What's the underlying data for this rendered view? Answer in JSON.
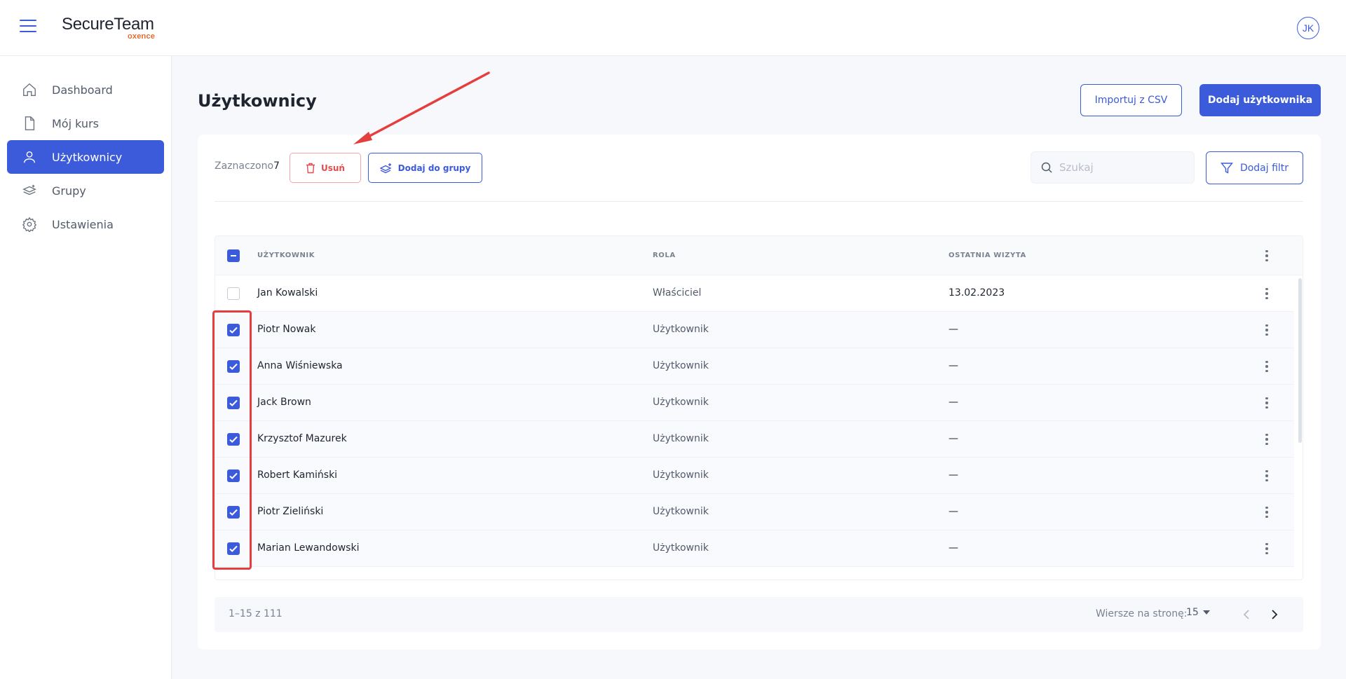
{
  "header": {
    "logo_main": "SecureTeam",
    "logo_sub": "oxence",
    "avatar_initials": "JK"
  },
  "sidebar": {
    "items": [
      {
        "label": "Dashboard",
        "icon": "home-icon"
      },
      {
        "label": "Mój kurs",
        "icon": "document-icon"
      },
      {
        "label": "Użytkownicy",
        "icon": "user-icon",
        "active": true
      },
      {
        "label": "Grupy",
        "icon": "layers-icon"
      },
      {
        "label": "Ustawienia",
        "icon": "gear-icon"
      }
    ]
  },
  "page": {
    "title": "Użytkownicy",
    "import_label": "Importuj z CSV",
    "add_user_label": "Dodaj użytkownika"
  },
  "toolbar": {
    "selected_label": "Zaznaczono",
    "selected_count": "7",
    "delete_label": "Usuń",
    "add_to_group_label": "Dodaj do grupy",
    "search_placeholder": "Szukaj",
    "filter_label": "Dodaj filtr"
  },
  "table": {
    "columns": [
      "UŻYTKOWNIK",
      "ROLA",
      "OSTATNIA WIZYTA"
    ],
    "rows": [
      {
        "name": "Jan Kowalski",
        "role": "Właściciel",
        "last_visit": "13.02.2023",
        "checked": false
      },
      {
        "name": "Piotr Nowak",
        "role": "Użytkownik",
        "last_visit": "—",
        "checked": true
      },
      {
        "name": "Anna Wiśniewska",
        "role": "Użytkownik",
        "last_visit": "—",
        "checked": true
      },
      {
        "name": "Jack Brown",
        "role": "Użytkownik",
        "last_visit": "—",
        "checked": true
      },
      {
        "name": "Krzysztof Mazurek",
        "role": "Użytkownik",
        "last_visit": "—",
        "checked": true
      },
      {
        "name": "Robert Kamiński",
        "role": "Użytkownik",
        "last_visit": "—",
        "checked": true
      },
      {
        "name": "Piotr Zieliński",
        "role": "Użytkownik",
        "last_visit": "—",
        "checked": true
      },
      {
        "name": "Marian Lewandowski",
        "role": "Użytkownik",
        "last_visit": "—",
        "checked": true
      }
    ]
  },
  "pagination": {
    "range": "1–15 z 111",
    "rows_per_page_label": "Wiersze na stronę:",
    "rows_per_page_value": "15"
  },
  "colors": {
    "accent": "#3b5bdb",
    "danger": "#e24c4c",
    "annotation": "#e53e3e"
  }
}
